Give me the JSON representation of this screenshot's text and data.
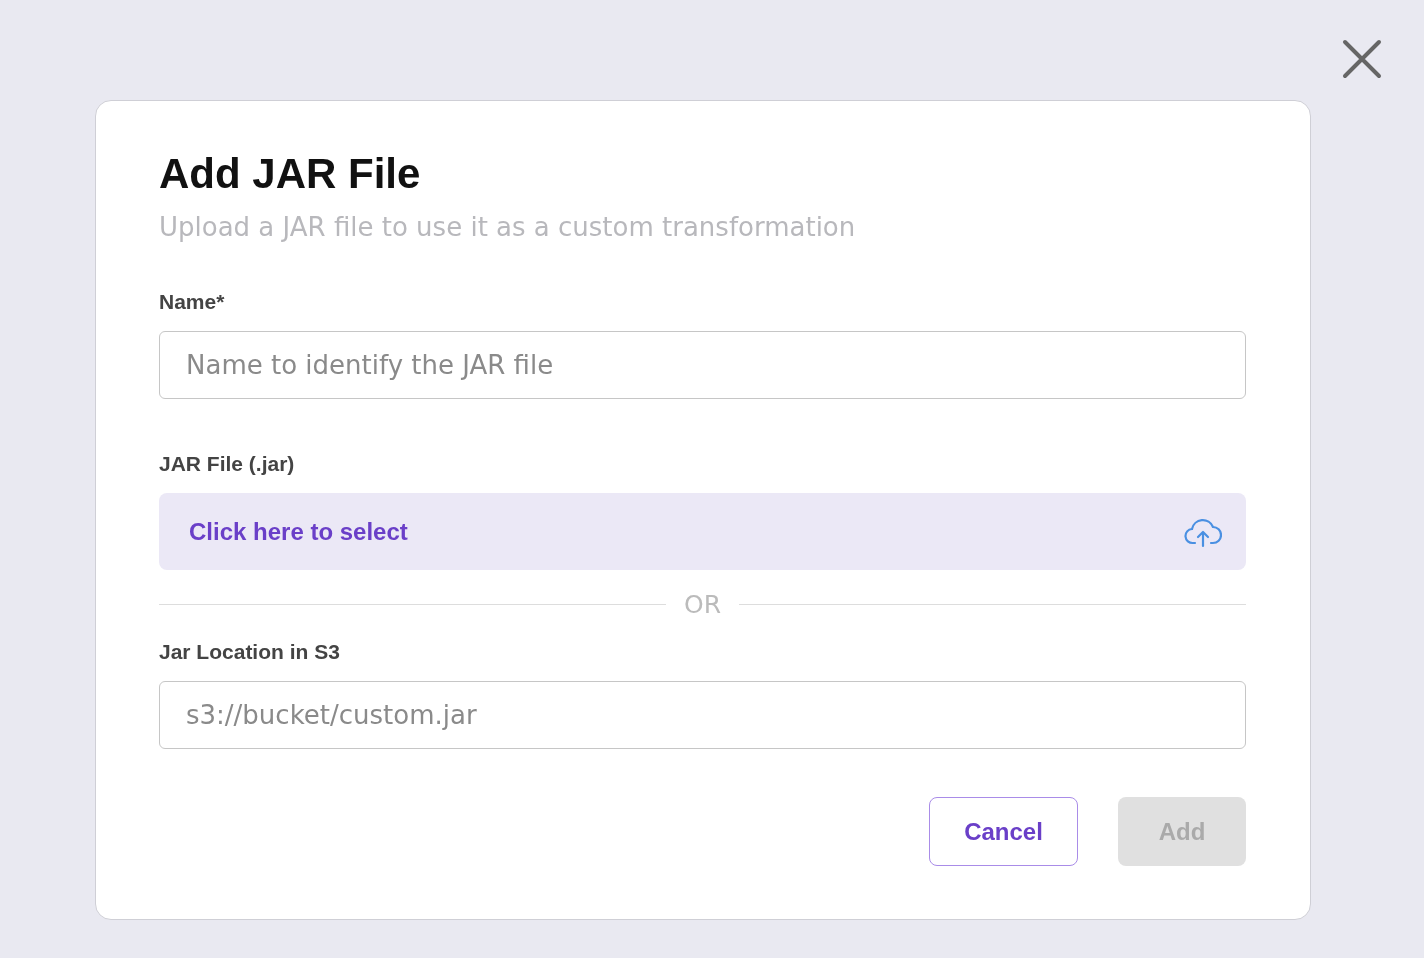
{
  "dialog": {
    "title": "Add JAR File",
    "subtitle": "Upload a JAR file to use it as a custom transformation",
    "name_field": {
      "label": "Name*",
      "placeholder": "Name to identify the JAR file"
    },
    "file_field": {
      "label": "JAR File (.jar)",
      "prompt": "Click here to select"
    },
    "divider": "OR",
    "s3_field": {
      "label": "Jar Location in S3",
      "placeholder": "s3://bucket/custom.jar"
    },
    "buttons": [
      {
        "label": "Cancel",
        "kind": "secondary",
        "disabled": false
      },
      {
        "label": "Add",
        "kind": "primary",
        "disabled": true
      }
    ]
  }
}
